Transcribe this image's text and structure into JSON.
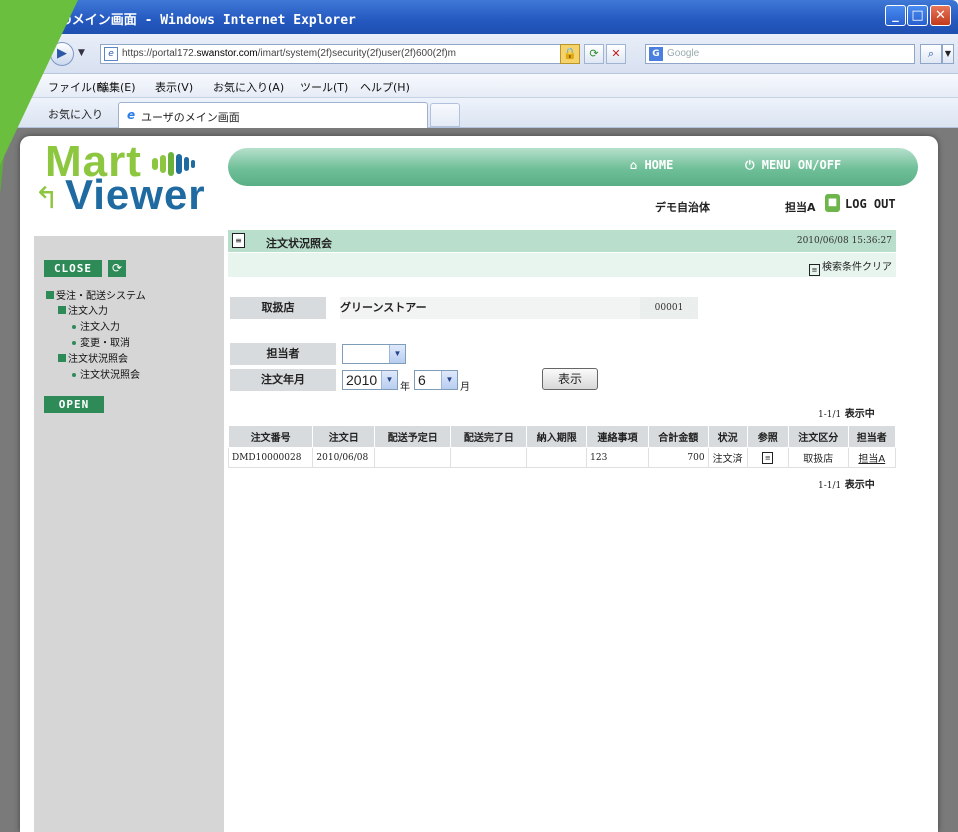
{
  "window": {
    "title": "ユーザのメイン画面 - Windows Internet Explorer",
    "buttons": {
      "min": "_",
      "max": "□",
      "close": "✕"
    }
  },
  "addressbar": {
    "url_prefix": "https://portal172.",
    "url_domain": "swanstor.com",
    "url_rest": "/imart/system(2f)security(2f)user(2f)600(2f)m",
    "search_placeholder": "Google"
  },
  "menubar": {
    "items": [
      "ファイル(F)",
      "編集(E)",
      "表示(V)",
      "お気に入り(A)",
      "ツール(T)",
      "ヘルプ(H)"
    ]
  },
  "favbar": {
    "favorites_label": "お気に入り",
    "tab_label": "ユーザのメイン画面"
  },
  "logo": {
    "top": "Mart",
    "bottom": "Viewer"
  },
  "header": {
    "home": "HOME",
    "menu": "MENU ON/OFF",
    "org": "デモ自治体",
    "user": "担当A",
    "logout": "LOG OUT"
  },
  "sidebar": {
    "close_label": "CLOSE",
    "open_label": "OPEN",
    "tree": [
      {
        "label": "受注・配送システム",
        "level": 0
      },
      {
        "label": "注文入力",
        "level": 1
      },
      {
        "label": "注文入力",
        "level": 2
      },
      {
        "label": "変更・取消",
        "level": 2
      },
      {
        "label": "注文状況照会",
        "level": 1
      },
      {
        "label": "注文状況照会",
        "level": 2
      }
    ]
  },
  "main": {
    "section_title": "注文状況照会",
    "timestamp": "2010/06/08 15:36:27",
    "clear_label": "検索条件クリア",
    "store_label": "取扱店",
    "store_name": "グリーンストアー",
    "store_code": "00001",
    "staff_label": "担当者",
    "staff_value": "",
    "month_label": "注文年月",
    "year_value": "2010",
    "year_unit": "年",
    "month_value": "6",
    "month_unit": "月",
    "show_button": "表示",
    "count_num": "1-1/1",
    "count_suffix": "表示中"
  },
  "table": {
    "headers": [
      "注文番号",
      "注文日",
      "配送予定日",
      "配送完了日",
      "納入期限",
      "連絡事項",
      "合計金額",
      "状況",
      "参照",
      "注文区分",
      "担当者"
    ],
    "rows": [
      [
        "DMD10000028",
        "2010/06/08",
        "",
        "",
        "",
        "123",
        "700",
        "注文済",
        "",
        "取扱店",
        "担当A"
      ]
    ]
  },
  "colors": {
    "accent_green": "#2e8b57",
    "header_band": "#6fbf98",
    "logo_green": "#8dc63f",
    "logo_blue": "#1f6aa0"
  }
}
